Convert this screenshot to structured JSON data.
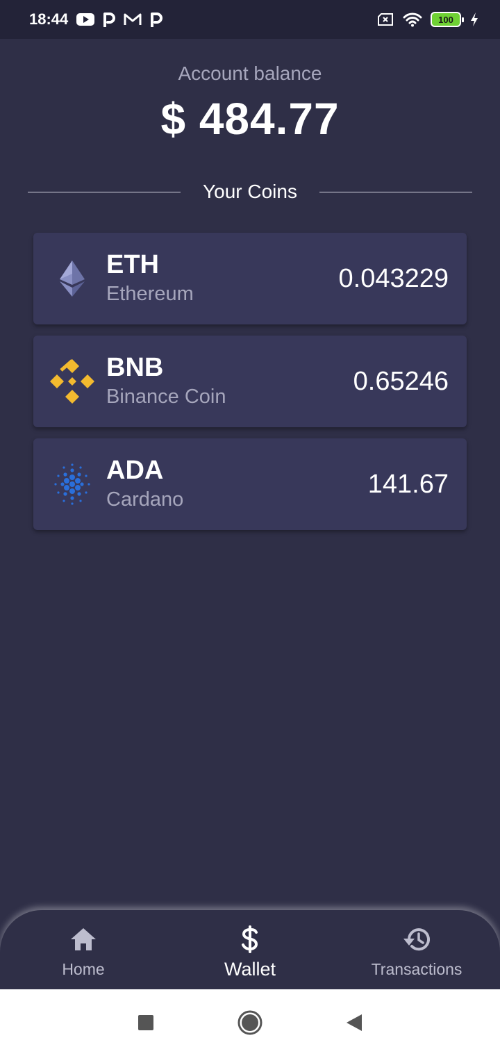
{
  "status_bar": {
    "time": "18:44",
    "battery_level": "100",
    "icons": [
      "youtube-icon",
      "p-icon",
      "gmail-icon",
      "p-icon",
      "sim-x-icon",
      "wifi-icon",
      "battery-icon",
      "charging-icon"
    ]
  },
  "balance": {
    "label": "Account balance",
    "value": "$ 484.77"
  },
  "section": {
    "title": "Your Coins"
  },
  "coins": [
    {
      "symbol": "ETH",
      "name": "Ethereum",
      "amount": "0.043229",
      "icon": "ethereum-icon"
    },
    {
      "symbol": "BNB",
      "name": "Binance Coin",
      "amount": "0.65246",
      "icon": "binance-icon"
    },
    {
      "symbol": "ADA",
      "name": "Cardano",
      "amount": "141.67",
      "icon": "cardano-icon"
    }
  ],
  "nav": {
    "items": [
      {
        "label": "Home",
        "icon": "home-icon",
        "active": false
      },
      {
        "label": "Wallet",
        "icon": "dollar-icon",
        "active": true
      },
      {
        "label": "Transactions",
        "icon": "history-icon",
        "active": false
      }
    ]
  },
  "colors": {
    "background": "#2f2f47",
    "card": "#38385a",
    "status_bar": "#232338",
    "muted_text": "#a6a6bc",
    "bnb_yellow": "#f3ba2f",
    "ada_blue": "#2a6fdb",
    "eth_gray": "#6e74a8"
  }
}
